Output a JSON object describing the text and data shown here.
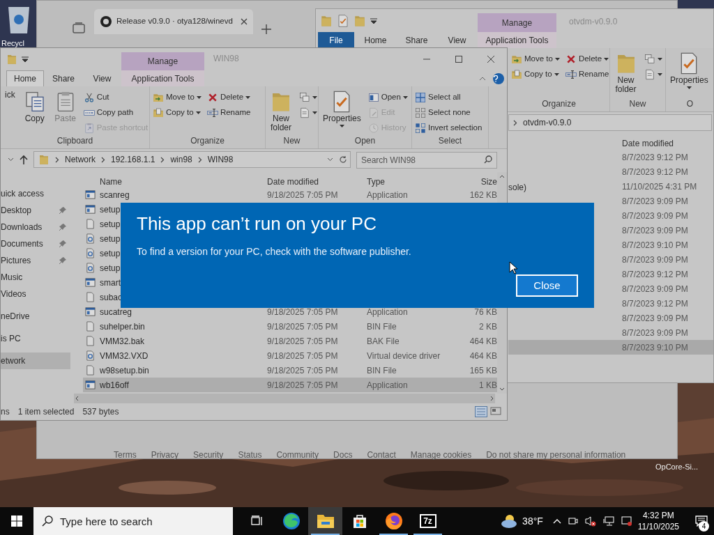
{
  "desktop_icons": [
    {
      "label": "Recycl"
    },
    {
      "label": "OpCore-Si..."
    }
  ],
  "browser": {
    "tab": {
      "title": "Release v0.9.0 · otya128/winevd"
    },
    "footer_links": [
      "Terms",
      "Privacy",
      "Security",
      "Status",
      "Community",
      "Docs",
      "Contact",
      "Manage cookies",
      "Do not share my personal information"
    ]
  },
  "right_explorer": {
    "title": "otvdm-v0.9.0",
    "context_tab": "Manage",
    "tabs": [
      {
        "label": "File",
        "kind": "file",
        "selected": false
      },
      {
        "label": "Home",
        "kind": "plain",
        "selected": false
      },
      {
        "label": "Share",
        "kind": "plain",
        "selected": false
      },
      {
        "label": "View",
        "kind": "plain",
        "selected": false
      },
      {
        "label": "Application Tools",
        "kind": "context",
        "selected": false
      }
    ],
    "ribbon": [
      {
        "label": "Organize",
        "items": [
          {
            "kind": "column",
            "items": [
              {
                "label": "Move to",
                "dropdown": true,
                "disabled": false
              },
              {
                "label": "Copy to",
                "dropdown": true,
                "disabled": false
              }
            ]
          },
          {
            "kind": "column",
            "items": [
              {
                "label": "Delete",
                "dropdown": true,
                "disabled": false
              },
              {
                "label": "Rename",
                "dropdown": false,
                "disabled": false
              }
            ]
          }
        ]
      },
      {
        "label": "New",
        "items": [
          {
            "kind": "large",
            "label": "New folder",
            "dropdown": false,
            "disabled": false
          },
          {
            "kind": "column",
            "items": [
              {
                "dropdown": true,
                "disabled": false
              },
              {
                "dropdown": true,
                "disabled": false
              }
            ]
          }
        ]
      },
      {
        "label": "O",
        "items": [
          {
            "kind": "large",
            "label": "Properties",
            "dropdown": true,
            "disabled": false
          }
        ]
      }
    ],
    "address": "otvdm-v0.9.0",
    "date_header": "Date modified",
    "rows": [
      {
        "date": "8/7/2023 9:12 PM",
        "selected": false
      },
      {
        "date": "8/7/2023 9:12 PM",
        "selected": false
      },
      {
        "name": "sole)",
        "date": "11/10/2025 4:31 PM",
        "selected": false
      },
      {
        "date": "8/7/2023 9:09 PM",
        "selected": false
      },
      {
        "date": "8/7/2023 9:09 PM",
        "selected": false
      },
      {
        "date": "8/7/2023 9:09 PM",
        "selected": false
      },
      {
        "date": "8/7/2023 9:10 PM",
        "selected": false
      },
      {
        "date": "8/7/2023 9:09 PM",
        "selected": false
      },
      {
        "date": "8/7/2023 9:12 PM",
        "selected": false
      },
      {
        "date": "8/7/2023 9:09 PM",
        "selected": false
      },
      {
        "date": "8/7/2023 9:12 PM",
        "selected": false
      },
      {
        "date": "8/7/2023 9:09 PM",
        "selected": false
      },
      {
        "date": "8/7/2023 9:09 PM",
        "selected": false
      },
      {
        "date": "8/7/2023 9:10 PM",
        "selected": true
      }
    ]
  },
  "left_explorer": {
    "title": "WIN98",
    "context_tab": "Manage",
    "tabs": [
      {
        "label": "Home",
        "kind": "plain",
        "selected": true
      },
      {
        "label": "Share",
        "kind": "plain",
        "selected": false
      },
      {
        "label": "View",
        "kind": "plain",
        "selected": false
      },
      {
        "label": "Application Tools",
        "kind": "context",
        "selected": false
      }
    ],
    "ribbon": [
      {
        "label": "Clipboard",
        "items": [
          {
            "kind": "large",
            "label": "ick",
            "dropdown": false,
            "disabled": false
          },
          {
            "kind": "large",
            "label": "Copy",
            "dropdown": false,
            "disabled": false
          },
          {
            "kind": "large",
            "label": "Paste",
            "dropdown": false,
            "disabled": true
          },
          {
            "kind": "column",
            "items": [
              {
                "label": "Cut",
                "dropdown": false,
                "disabled": false
              },
              {
                "label": "Copy path",
                "dropdown": false,
                "disabled": false
              },
              {
                "label": "Paste shortcut",
                "dropdown": false,
                "disabled": true
              }
            ]
          }
        ]
      },
      {
        "label": "Organize",
        "items": [
          {
            "kind": "column",
            "items": [
              {
                "label": "Move to",
                "dropdown": true,
                "disabled": false
              },
              {
                "label": "Copy to",
                "dropdown": true,
                "disabled": false
              }
            ]
          },
          {
            "kind": "column",
            "items": [
              {
                "label": "Delete",
                "dropdown": true,
                "disabled": false
              },
              {
                "label": "Rename",
                "dropdown": false,
                "disabled": false
              }
            ]
          }
        ]
      },
      {
        "label": "New",
        "items": [
          {
            "kind": "large",
            "label": "New folder",
            "dropdown": false,
            "disabled": false
          },
          {
            "kind": "column",
            "items": [
              {
                "dropdown": true,
                "disabled": false
              },
              {
                "dropdown": true,
                "disabled": false
              }
            ]
          }
        ]
      },
      {
        "label": "Open",
        "items": [
          {
            "kind": "large",
            "label": "Properties",
            "dropdown": true,
            "disabled": false
          },
          {
            "kind": "column",
            "items": [
              {
                "label": "Open",
                "dropdown": true,
                "disabled": false
              },
              {
                "label": "Edit",
                "dropdown": false,
                "disabled": true
              },
              {
                "label": "History",
                "dropdown": false,
                "disabled": true
              }
            ]
          }
        ]
      },
      {
        "label": "Select",
        "items": [
          {
            "kind": "column",
            "items": [
              {
                "label": "Select all",
                "dropdown": false,
                "disabled": false
              },
              {
                "label": "Select none",
                "dropdown": false,
                "disabled": false
              },
              {
                "label": "Invert selection",
                "dropdown": false,
                "disabled": false
              }
            ]
          }
        ]
      }
    ],
    "breadcrumb": [
      "Network",
      "192.168.1.1",
      "win98",
      "WIN98"
    ],
    "search": {
      "placeholder": "Search WIN98"
    },
    "nav": [
      {
        "label": "uick access",
        "kind": "root",
        "pinned": false,
        "selected": false
      },
      {
        "label": "Desktop",
        "kind": "child",
        "pinned": true,
        "selected": false
      },
      {
        "label": "Downloads",
        "kind": "child",
        "pinned": true,
        "selected": false
      },
      {
        "label": "Documents",
        "kind": "child",
        "pinned": true,
        "selected": false
      },
      {
        "label": "Pictures",
        "kind": "child",
        "pinned": true,
        "selected": false
      },
      {
        "label": "Music",
        "kind": "child",
        "pinned": false,
        "selected": false
      },
      {
        "label": "Videos",
        "kind": "child",
        "pinned": false,
        "selected": false
      },
      {
        "label": "neDrive",
        "kind": "root",
        "pinned": false,
        "selected": false
      },
      {
        "label": "is PC",
        "kind": "root",
        "pinned": false,
        "selected": false
      },
      {
        "label": "etwork",
        "kind": "root",
        "pinned": false,
        "selected": true
      }
    ],
    "columns": [
      "Name",
      "Date modified",
      "Type",
      "Size"
    ],
    "rows": [
      {
        "kind": "application",
        "name": "scanreg",
        "date": "9/18/2025 7:05 PM",
        "type": "Application",
        "size": "162 KB",
        "selected": false
      },
      {
        "kind": "application",
        "name": "setup",
        "selected": false
      },
      {
        "kind": "file",
        "name": "setup",
        "selected": false
      },
      {
        "kind": "settings",
        "name": "setup",
        "selected": false
      },
      {
        "kind": "settings",
        "name": "setup",
        "selected": false
      },
      {
        "kind": "settings",
        "name": "setup",
        "selected": false
      },
      {
        "kind": "application",
        "name": "smart",
        "selected": false
      },
      {
        "kind": "file",
        "name": "subac",
        "selected": false
      },
      {
        "kind": "application",
        "name": "sucatreg",
        "date": "9/18/2025 7:05 PM",
        "type": "Application",
        "size": "76 KB",
        "selected": false
      },
      {
        "kind": "file",
        "name": "suhelper.bin",
        "date": "9/18/2025 7:05 PM",
        "type": "BIN File",
        "size": "2 KB",
        "selected": false
      },
      {
        "kind": "file",
        "name": "VMM32.bak",
        "date": "9/18/2025 7:05 PM",
        "type": "BAK File",
        "size": "464 KB",
        "selected": false
      },
      {
        "kind": "settings",
        "name": "VMM32.VXD",
        "date": "9/18/2025 7:05 PM",
        "type": "Virtual device driver",
        "size": "464 KB",
        "selected": false
      },
      {
        "kind": "file",
        "name": "w98setup.bin",
        "date": "9/18/2025 7:05 PM",
        "type": "BIN File",
        "size": "165 KB",
        "selected": false
      },
      {
        "kind": "application",
        "name": "wb16off",
        "date": "9/18/2025 7:05 PM",
        "type": "Application",
        "size": "1 KB",
        "selected": true
      }
    ],
    "status": [
      "ns",
      "1 item selected",
      "537 bytes"
    ]
  },
  "dialog": {
    "title": "This app can’t run on your PC",
    "message": "To find a version for your PC, check with the software publisher.",
    "button": "Close"
  },
  "taskbar": {
    "search": {
      "placeholder": "Type here to search"
    },
    "apps": [
      {
        "kind": "taskview",
        "running": false,
        "active": false
      },
      {
        "kind": "edge",
        "running": false,
        "active": false
      },
      {
        "kind": "explorer",
        "running": true,
        "active": true
      },
      {
        "kind": "store",
        "running": false,
        "active": false
      },
      {
        "kind": "firefox",
        "running": true,
        "active": false
      },
      {
        "kind": "archiver",
        "label": "7z",
        "running": true,
        "active": false
      }
    ],
    "weather": "38°F",
    "time": "4:32 PM",
    "date": "11/10/2025",
    "notifications": "4"
  }
}
